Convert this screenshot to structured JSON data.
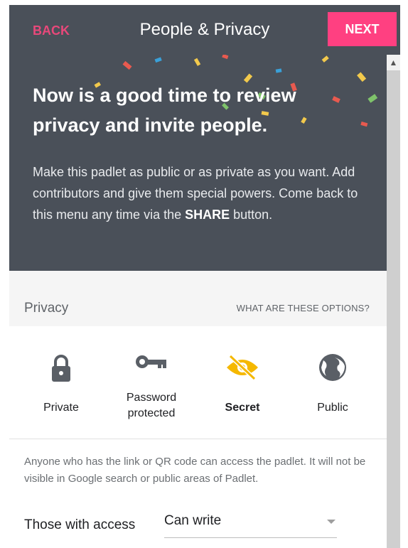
{
  "header": {
    "back_label": "BACK",
    "title": "People & Privacy",
    "next_label": "NEXT"
  },
  "hero": {
    "heading": "Now is a good time to review privacy and invite people.",
    "body_text": "Make this padlet as public or as private as you want. Add contributors and give them special powers. Come back to this menu any time via the ",
    "body_strong": "SHARE",
    "body_tail": " button."
  },
  "privacy": {
    "label": "Privacy",
    "help_link": "WHAT ARE THESE OPTIONS?",
    "options": [
      {
        "label": "Private",
        "icon": "lock-icon",
        "selected": false
      },
      {
        "label": "Password protected",
        "icon": "key-icon",
        "selected": false
      },
      {
        "label": "Secret",
        "icon": "eye-off-icon",
        "selected": true
      },
      {
        "label": "Public",
        "icon": "globe-icon",
        "selected": false
      }
    ],
    "description": "Anyone who has the link or QR code can access the padlet. It will not be visible in Google search or public areas of Padlet."
  },
  "access": {
    "label": "Those with access",
    "value": "Can write"
  },
  "colors": {
    "header_bg": "#4a5059",
    "accent": "#ff4081",
    "back_text": "#e8487a",
    "selected_icon": "#f5b800",
    "icon_default": "#5a5f66"
  }
}
